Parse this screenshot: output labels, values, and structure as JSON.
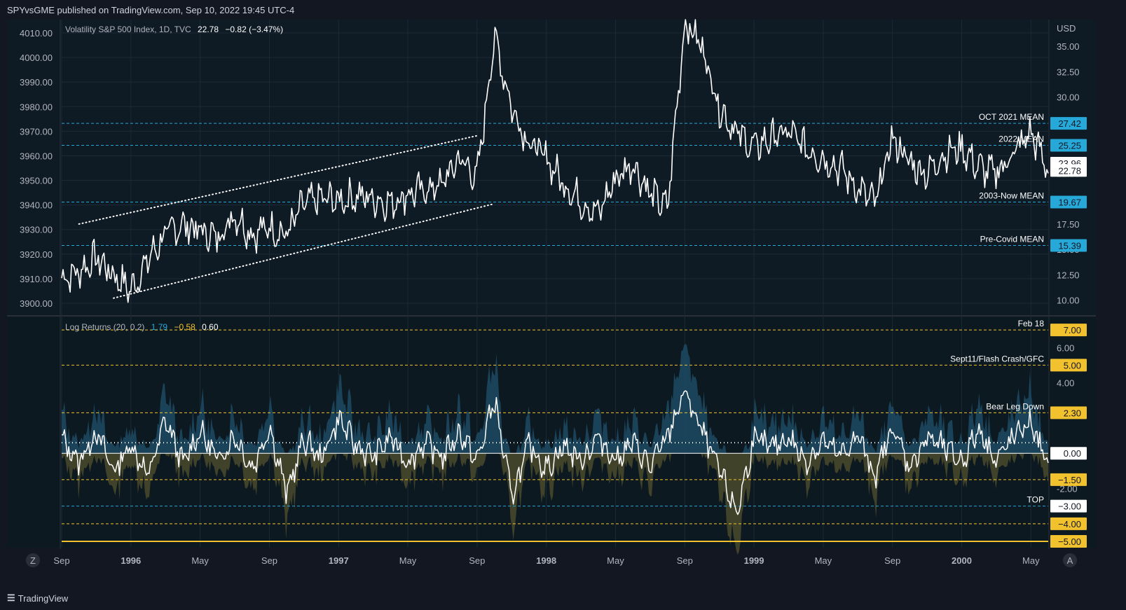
{
  "header": {
    "publisher": "SPYvsGME published on TradingView.com, Sep 10, 2022 19:45 UTC-4"
  },
  "footer": {
    "brand": "TradingView"
  },
  "colors": {
    "background": "#131722",
    "panel": "#0f1b26",
    "line": "#ffffff",
    "level_blue": "#26a8d9",
    "level_yellow": "#f2c12e",
    "upper_band": "#1d4a63",
    "lower_band": "#4a4a2a"
  },
  "main_legend": {
    "symbol": "Volatility S&P 500 Index, 1D, TVC",
    "last": "22.78",
    "change": "−0.82 (−3.47%)"
  },
  "sub_legend": {
    "name": "Log Returns (20, 0.2)",
    "v1": "1.79",
    "v2": "−0.58",
    "v3": "0.60"
  },
  "left_axis_labels": [
    "4010.00",
    "4000.00",
    "3990.00",
    "3980.00",
    "3970.00",
    "3960.00",
    "3950.00",
    "3940.00",
    "3930.00",
    "3920.00",
    "3910.00",
    "3900.00"
  ],
  "right_axis": {
    "unit": "USD",
    "ticks": [
      "35.00",
      "32.50",
      "30.00",
      "27.50",
      "25.00",
      "22.50",
      "20.00",
      "17.50",
      "15.00",
      "12.50",
      "10.00"
    ],
    "badges": [
      {
        "value": "27.42",
        "style": "blue"
      },
      {
        "value": "25.25",
        "style": "blue"
      },
      {
        "value": "23.96",
        "style": "white"
      },
      {
        "value": "22.78",
        "style": "white"
      },
      {
        "value": "19.67",
        "style": "blue"
      },
      {
        "value": "15.39",
        "style": "blue"
      }
    ]
  },
  "main_levels": [
    {
      "label": "OCT 2021 MEAN",
      "value": 27.42
    },
    {
      "label": "2022 MEAN",
      "value": 25.25
    },
    {
      "label": "2003-Now MEAN",
      "value": 19.67
    },
    {
      "label": "Pre-Covid MEAN",
      "value": 15.39
    }
  ],
  "sub_axis": {
    "ticks": [
      "6.00",
      "4.00",
      "-2.00"
    ]
  },
  "sub_levels": [
    {
      "label": "Feb 18",
      "value": 7.0,
      "badge": "7.00",
      "style": "yellow"
    },
    {
      "label": "Sept11/Flash Crash/GFC",
      "value": 5.0,
      "badge": "5.00",
      "style": "yellow"
    },
    {
      "label": "Bear Leg Down",
      "value": 2.3,
      "badge": "2.30",
      "style": "yellow"
    },
    {
      "label": "",
      "value": 0.0,
      "badge": "0.00",
      "style": "white"
    },
    {
      "label": "",
      "value": -1.5,
      "badge": "−1.50",
      "style": "yellow"
    },
    {
      "label": "TOP",
      "value": -3.0,
      "badge": "−3.00",
      "style": "white"
    },
    {
      "label": "",
      "value": -4.0,
      "badge": "−4.00",
      "style": "yellow"
    },
    {
      "label": "",
      "value": -5.0,
      "badge": "−5.00",
      "style": "yellow"
    }
  ],
  "time_axis": [
    "Sep",
    "1996",
    "May",
    "Sep",
    "1997",
    "May",
    "Sep",
    "1998",
    "May",
    "Sep",
    "1999",
    "May",
    "Sep",
    "2000",
    "May"
  ],
  "corner_buttons": {
    "left": "Z",
    "right": "A"
  },
  "chart_data": [
    {
      "type": "line",
      "title": "Volatility S&P 500 Index, 1D, TVC",
      "ylabel": "USD",
      "ylim": [
        8.8,
        37.5
      ],
      "x": [
        "1995-09",
        "1995-10",
        "1995-11",
        "1995-12",
        "1996-01",
        "1996-02",
        "1996-03",
        "1996-04",
        "1996-05",
        "1996-06",
        "1996-07",
        "1996-08",
        "1996-09",
        "1996-10",
        "1996-11",
        "1996-12",
        "1997-01",
        "1997-02",
        "1997-03",
        "1997-04",
        "1997-05",
        "1997-06",
        "1997-07",
        "1997-08",
        "1997-09",
        "1997-10",
        "1997-11",
        "1997-12",
        "1998-01",
        "1998-02",
        "1998-03",
        "1998-04",
        "1998-05",
        "1998-06",
        "1998-07",
        "1998-08",
        "1998-09",
        "1998-10",
        "1998-11",
        "1998-12",
        "1999-01",
        "1999-02",
        "1999-03",
        "1999-04",
        "1999-05",
        "1999-06",
        "1999-07",
        "1999-08",
        "1999-09",
        "1999-10",
        "1999-11",
        "1999-12",
        "2000-01",
        "2000-02",
        "2000-03",
        "2000-04",
        "2000-05",
        "2000-06"
      ],
      "values": [
        12.2,
        12.8,
        14.2,
        12.5,
        11.0,
        14.0,
        16.5,
        17.5,
        16.8,
        16.2,
        18.5,
        16.5,
        17.2,
        16.5,
        19.5,
        20.0,
        19.8,
        20.3,
        20.0,
        19.6,
        20.5,
        20.8,
        21.5,
        24.0,
        22.0,
        36.0,
        29.0,
        25.5,
        24.0,
        21.5,
        19.8,
        18.5,
        22.0,
        23.5,
        20.5,
        19.0,
        37.5,
        35.0,
        29.0,
        26.5,
        25.0,
        26.0,
        26.5,
        25.0,
        24.0,
        23.0,
        21.0,
        19.5,
        26.0,
        23.5,
        22.5,
        24.5,
        25.0,
        23.0,
        22.5,
        24.5,
        26.5,
        22.8
      ],
      "series": [
        {
          "name": "upper channel",
          "points": [
            [
              "1995-10",
              17.5
            ],
            [
              "1997-09",
              26.2
            ]
          ]
        },
        {
          "name": "lower channel",
          "points": [
            [
              "1995-12",
              10.2
            ],
            [
              "1997-10",
              19.5
            ]
          ]
        }
      ],
      "hlines": [
        27.42,
        25.25,
        19.67,
        15.39
      ]
    },
    {
      "type": "line",
      "title": "Log Returns (20, 0.2)",
      "ylim": [
        -5.2,
        7.6
      ],
      "x": [
        "1995-09",
        "1995-10",
        "1995-11",
        "1995-12",
        "1996-01",
        "1996-02",
        "1996-03",
        "1996-04",
        "1996-05",
        "1996-06",
        "1996-07",
        "1996-08",
        "1996-09",
        "1996-10",
        "1996-11",
        "1996-12",
        "1997-01",
        "1997-02",
        "1997-03",
        "1997-04",
        "1997-05",
        "1997-06",
        "1997-07",
        "1997-08",
        "1997-09",
        "1997-10",
        "1997-11",
        "1997-12",
        "1998-01",
        "1998-02",
        "1998-03",
        "1998-04",
        "1998-05",
        "1998-06",
        "1998-07",
        "1998-08",
        "1998-09",
        "1998-10",
        "1998-11",
        "1998-12",
        "1999-01",
        "1999-02",
        "1999-03",
        "1999-04",
        "1999-05",
        "1999-06",
        "1999-07",
        "1999-08",
        "1999-09",
        "1999-10",
        "1999-11",
        "1999-12",
        "2000-01",
        "2000-02",
        "2000-03",
        "2000-04",
        "2000-05",
        "2000-06"
      ],
      "values": [
        0.8,
        -0.5,
        1.2,
        -1.0,
        0.5,
        -1.3,
        1.9,
        -0.6,
        1.3,
        -0.4,
        1.0,
        -0.9,
        1.5,
        -2.3,
        0.8,
        -0.3,
        2.0,
        0.4,
        -0.2,
        0.9,
        -0.5,
        0.6,
        -0.2,
        1.2,
        -0.5,
        3.1,
        -2.5,
        0.5,
        -0.9,
        0.4,
        -0.4,
        0.9,
        -0.4,
        0.6,
        -0.8,
        1.0,
        3.5,
        1.2,
        -1.0,
        -3.4,
        0.8,
        0.3,
        0.9,
        -0.5,
        0.7,
        -0.2,
        1.0,
        -1.3,
        1.5,
        -0.8,
        0.9,
        0.3,
        -0.5,
        1.4,
        -0.4,
        0.9,
        1.8,
        -0.9
      ],
      "hlines": [
        7.0,
        5.0,
        2.3,
        0.0,
        -1.5,
        -3.0,
        -4.0,
        -5.0
      ]
    }
  ]
}
